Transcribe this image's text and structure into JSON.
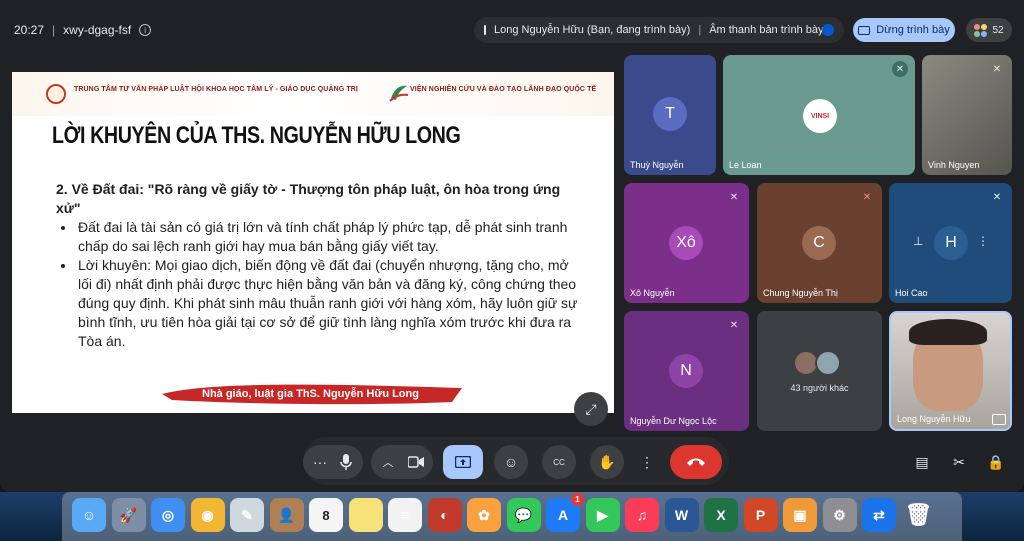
{
  "meeting": {
    "time": "20:27",
    "separator": "|",
    "code": "xwy-dgag-fsf",
    "info_icon": "info-icon"
  },
  "presenting": {
    "label": "Long Nguyễn Hữu (Bạn, đang trình bày)",
    "sep": "|",
    "audio_label": "Âm thanh bản trình bày",
    "stop_label": "Dừng trình bày"
  },
  "participants_count": "52",
  "slide": {
    "org_left": "TRUNG TÂM TƯ VẤN PHÁP LUẬT  HỘI KHOA HỌC TÂM LÝ - GIÁO DỤC QUẢNG TRỊ",
    "org_right": "VIỆN NGHIÊN CỨU VÀ ĐÀO TẠO LÃNH ĐẠO QUỐC TẾ",
    "title": "LỜI KHUYÊN CỦA THS. NGUYỄN HỮU LONG",
    "heading": "2. Về Đất đai: \"Rõ ràng về giấy tờ - Thượng tôn pháp luật, ôn hòa trong ứng xử\"",
    "bullets": [
      "Đất đai là tài sản có giá trị lớn và tính chất pháp lý phức tạp, dễ phát sinh tranh chấp do sai lệch ranh giới hay mua bán bằng giấy viết tay.",
      "Lời khuyên: Mọi giao dịch, biến động về đất đai (chuyển nhượng, tặng cho, mở lối đi) nhất định phải được thực hiện bằng văn bản và đăng ký, công chứng theo đúng quy định. Khi phát sinh mâu thuẫn ranh giới với hàng xóm, hãy luôn giữ sự bình tĩnh, ưu tiên hòa giải tại cơ sở để giữ tình làng nghĩa xóm trước khi đưa ra Tòa án."
    ],
    "signature": "Nhà giáo, luật gia ThS. Nguyễn Hữu Long"
  },
  "tiles": [
    {
      "name": "Thuỳ Nguyễn",
      "initial": "T",
      "bg": "#3b4a8a",
      "avatar": "#5b6bc0"
    },
    {
      "name": "Le Loan",
      "logo": "VINSI",
      "bg": "#6b9a91"
    },
    {
      "name": "Vinh Nguyen",
      "bg": "#7a7a72"
    },
    {
      "name": "Xô Nguyễn",
      "initial": "Xô",
      "bg": "#7b2e8a",
      "avatar": "#a64bb8"
    },
    {
      "name": "Chung Nguyễn Thị",
      "initial": "C",
      "bg": "#6a4030",
      "avatar": "#9a6a52"
    },
    {
      "name": "Hoi Cao",
      "initial": "H",
      "bg": "#1f4c7a",
      "avatar": "#2b5f92"
    },
    {
      "name": "Nguyễn Dư Ngọc Lộc",
      "initial": "N",
      "bg": "#6b2f82",
      "avatar": "#8c45a6"
    },
    {
      "name": "43 người khác",
      "bg": "#3c4043"
    },
    {
      "name": "Long Nguyễn Hữu",
      "bg": "#b7b3ae"
    }
  ],
  "controls": {
    "more_options": "···",
    "mic": "microphone-icon",
    "chevron": "chevron-up-icon",
    "camera": "camera-icon",
    "present": "present-screen-icon",
    "emoji": "emoji-icon",
    "captions": "captions-icon",
    "hand": "raise-hand-icon",
    "kebab": "more-vert-icon",
    "end": "end-call-icon"
  },
  "side_controls": [
    "chat-icon",
    "activities-icon",
    "host-controls-icon"
  ],
  "dock": [
    "Finder",
    "Launchpad",
    "Safari",
    "Chrome",
    "Preview",
    "Contacts",
    "Calendar",
    "Notes",
    "Reminders",
    "Photo Booth",
    "Photos",
    "Messages",
    "App Store",
    "FaceTime",
    "Music",
    "Word",
    "Excel",
    "PowerPoint",
    "Books",
    "System Preferences",
    "TeamViewer",
    "Trash"
  ],
  "dock_badge": "1",
  "calendar_day": "8"
}
